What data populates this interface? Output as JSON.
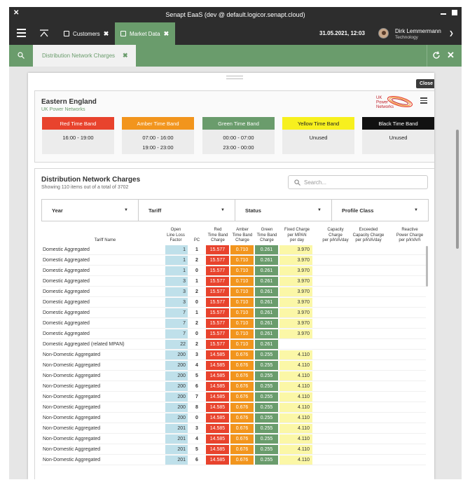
{
  "window": {
    "title": "Senapt EaaS (dev @ default.logicor.senapt.cloud)"
  },
  "nav": {
    "tabs": [
      {
        "label": "Customers",
        "icon": "customers-icon"
      },
      {
        "label": "Market Data",
        "icon": "market-data-icon"
      }
    ],
    "datetime": "31.05.2021, 12:03",
    "user": {
      "name": "Dirk Lemmermann",
      "role": "Technology"
    }
  },
  "subnav": {
    "tab_label": "Distribution Network Charges"
  },
  "panel": {
    "close_label": "Close"
  },
  "region": {
    "name": "Eastern England",
    "operator": "UK Power Networks",
    "logo_lines": [
      "UK",
      "Power",
      "Networks"
    ]
  },
  "bands": [
    {
      "name": "Red Time Band",
      "color": "#e8432d",
      "text": "#ffffff",
      "times": [
        "16:00 - 19:00"
      ]
    },
    {
      "name": "Amber Time Band",
      "color": "#f2951d",
      "text": "#ffffff",
      "times": [
        "07:00 - 16:00",
        "19:00 - 23:00"
      ]
    },
    {
      "name": "Green Time Band",
      "color": "#6a9c6c",
      "text": "#ffffff",
      "times": [
        "00:00 - 07:00",
        "23:00 - 00:00"
      ]
    },
    {
      "name": "Yellow Time Band",
      "color": "#f7f01e",
      "text": "#222222",
      "times": [
        "Unused"
      ]
    },
    {
      "name": "Black Time Band",
      "color": "#111111",
      "text": "#ffffff",
      "times": [
        "Unused"
      ]
    }
  ],
  "charges": {
    "title": "Distribution Network Charges",
    "subtitle": "Showing 110 items out of a total of 3702",
    "search_placeholder": "Search...",
    "filters": [
      "Year",
      "Tariff",
      "Status",
      "Profile Class"
    ],
    "columns": {
      "tariff_name": "Tariff Name",
      "llf": [
        "Open",
        "Line Loss",
        "Factor"
      ],
      "pc": "PC",
      "red": [
        "Red",
        "Time Band",
        "Charge"
      ],
      "amber": [
        "Amber",
        "Time Band",
        "Charge"
      ],
      "green": [
        "Green",
        "Time Band",
        "Charge"
      ],
      "fixed": [
        "Fixed Charge",
        "per MPAN",
        "per day"
      ],
      "capacity": [
        "Capacity",
        "Charge",
        "per p/kVA/day"
      ],
      "exceeded": [
        "Exceeded",
        "Capacity Charge",
        "per p/kVA/day"
      ],
      "reactive": [
        "Reactive",
        "Power Charge",
        "per p/kVArh"
      ]
    },
    "rows": [
      {
        "name": "Domestic Aggregated",
        "llf": "1",
        "pc": "1",
        "red": "15.577",
        "amber": "0.710",
        "green": "0.261",
        "fixed": "3.970"
      },
      {
        "name": "Domestic Aggregated",
        "llf": "1",
        "pc": "2",
        "red": "15.577",
        "amber": "0.710",
        "green": "0.261",
        "fixed": "3.970"
      },
      {
        "name": "Domestic Aggregated",
        "llf": "1",
        "pc": "0",
        "red": "15.577",
        "amber": "0.710",
        "green": "0.261",
        "fixed": "3.970"
      },
      {
        "name": "Domestic Aggregated",
        "llf": "3",
        "pc": "1",
        "red": "15.577",
        "amber": "0.710",
        "green": "0.261",
        "fixed": "3.970"
      },
      {
        "name": "Domestic Aggregated",
        "llf": "3",
        "pc": "2",
        "red": "15.577",
        "amber": "0.710",
        "green": "0.261",
        "fixed": "3.970"
      },
      {
        "name": "Domestic Aggregated",
        "llf": "3",
        "pc": "0",
        "red": "15.577",
        "amber": "0.710",
        "green": "0.261",
        "fixed": "3.970"
      },
      {
        "name": "Domestic Aggregated",
        "llf": "7",
        "pc": "1",
        "red": "15.577",
        "amber": "0.710",
        "green": "0.261",
        "fixed": "3.970"
      },
      {
        "name": "Domestic Aggregated",
        "llf": "7",
        "pc": "2",
        "red": "15.577",
        "amber": "0.710",
        "green": "0.261",
        "fixed": "3.970"
      },
      {
        "name": "Domestic Aggregated",
        "llf": "7",
        "pc": "0",
        "red": "15.577",
        "amber": "0.710",
        "green": "0.261",
        "fixed": "3.970"
      },
      {
        "name": "Domestic Aggregated (related MPAN)",
        "llf": "22",
        "pc": "2",
        "red": "15.577",
        "amber": "0.710",
        "green": "0.261",
        "fixed": ""
      },
      {
        "name": "Non-Domestic Aggregated",
        "llf": "200",
        "pc": "3",
        "red": "14.585",
        "amber": "0.676",
        "green": "0.255",
        "fixed": "4.110"
      },
      {
        "name": "Non-Domestic Aggregated",
        "llf": "200",
        "pc": "4",
        "red": "14.585",
        "amber": "0.676",
        "green": "0.255",
        "fixed": "4.110"
      },
      {
        "name": "Non-Domestic Aggregated",
        "llf": "200",
        "pc": "5",
        "red": "14.585",
        "amber": "0.676",
        "green": "0.255",
        "fixed": "4.110"
      },
      {
        "name": "Non-Domestic Aggregated",
        "llf": "200",
        "pc": "6",
        "red": "14.585",
        "amber": "0.676",
        "green": "0.255",
        "fixed": "4.110"
      },
      {
        "name": "Non-Domestic Aggregated",
        "llf": "200",
        "pc": "7",
        "red": "14.585",
        "amber": "0.676",
        "green": "0.255",
        "fixed": "4.110"
      },
      {
        "name": "Non-Domestic Aggregated",
        "llf": "200",
        "pc": "8",
        "red": "14.585",
        "amber": "0.676",
        "green": "0.255",
        "fixed": "4.110"
      },
      {
        "name": "Non-Domestic Aggregated",
        "llf": "200",
        "pc": "0",
        "red": "14.585",
        "amber": "0.676",
        "green": "0.255",
        "fixed": "4.110"
      },
      {
        "name": "Non-Domestic Aggregated",
        "llf": "201",
        "pc": "3",
        "red": "14.585",
        "amber": "0.676",
        "green": "0.255",
        "fixed": "4.110"
      },
      {
        "name": "Non-Domestic Aggregated",
        "llf": "201",
        "pc": "4",
        "red": "14.585",
        "amber": "0.676",
        "green": "0.255",
        "fixed": "4.110"
      },
      {
        "name": "Non-Domestic Aggregated",
        "llf": "201",
        "pc": "5",
        "red": "14.585",
        "amber": "0.676",
        "green": "0.255",
        "fixed": "4.110"
      },
      {
        "name": "Non-Domestic Aggregated",
        "llf": "201",
        "pc": "6",
        "red": "14.585",
        "amber": "0.676",
        "green": "0.255",
        "fixed": "4.110"
      }
    ]
  }
}
